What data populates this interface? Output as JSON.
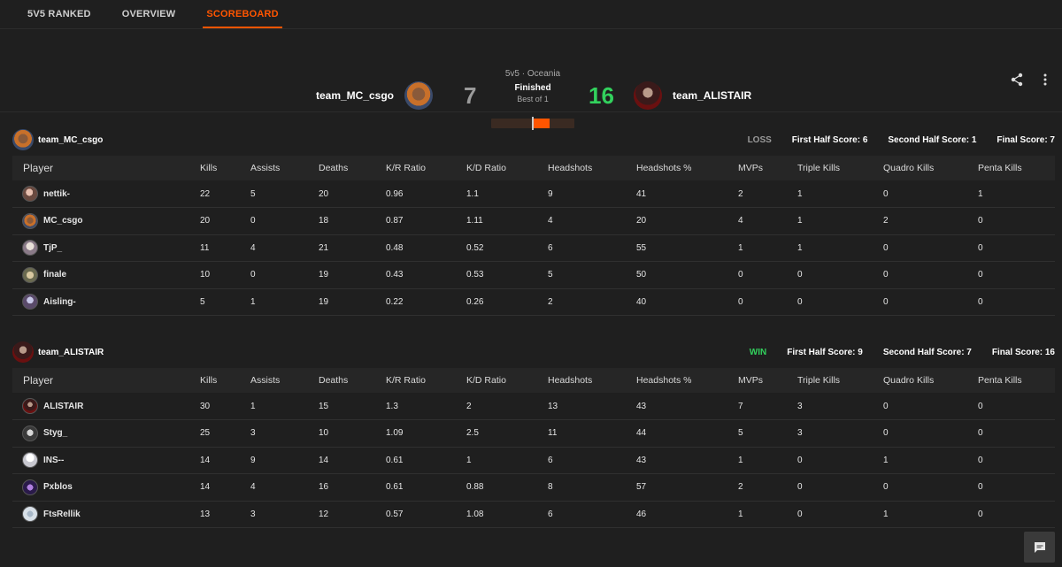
{
  "nav": {
    "tabs": [
      {
        "label": "5V5 RANKED"
      },
      {
        "label": "OVERVIEW"
      },
      {
        "label": "SCOREBOARD",
        "active": true
      }
    ]
  },
  "match": {
    "region": "5v5 · Oceania",
    "status": "Finished",
    "best_of": "Best of 1",
    "team_left": {
      "name": "team_MC_csgo",
      "score": "7"
    },
    "team_right": {
      "name": "team_ALISTAIR",
      "score": "16"
    },
    "progress_fraction": 0.4
  },
  "icons": {
    "share": "share-icon",
    "more": "more-vertical-icon",
    "chat": "chat-icon"
  },
  "colors": {
    "accent": "#ff5500",
    "win": "#32d15d",
    "loss": "#9a9a9a"
  },
  "columns": [
    "Player",
    "Kills",
    "Assists",
    "Deaths",
    "K/R Ratio",
    "K/D Ratio",
    "Headshots",
    "Headshots %",
    "MVPs",
    "Triple Kills",
    "Quadro Kills",
    "Penta Kills"
  ],
  "teams": [
    {
      "name": "team_MC_csgo",
      "result": "LOSS",
      "first_half": "First Half Score: 6",
      "second_half": "Second Half Score: 1",
      "final": "Final Score: 7",
      "players": [
        [
          "nettik-",
          "22",
          "5",
          "20",
          "0.96",
          "1.1",
          "9",
          "41",
          "2",
          "1",
          "0",
          "1"
        ],
        [
          "MC_csgo",
          "20",
          "0",
          "18",
          "0.87",
          "1.11",
          "4",
          "20",
          "4",
          "1",
          "2",
          "0"
        ],
        [
          "TjP_",
          "11",
          "4",
          "21",
          "0.48",
          "0.52",
          "6",
          "55",
          "1",
          "1",
          "0",
          "0"
        ],
        [
          "finale",
          "10",
          "0",
          "19",
          "0.43",
          "0.53",
          "5",
          "50",
          "0",
          "0",
          "0",
          "0"
        ],
        [
          "Aisling-",
          "5",
          "1",
          "19",
          "0.22",
          "0.26",
          "2",
          "40",
          "0",
          "0",
          "0",
          "0"
        ]
      ]
    },
    {
      "name": "team_ALISTAIR",
      "result": "WIN",
      "first_half": "First Half Score: 9",
      "second_half": "Second Half Score: 7",
      "final": "Final Score: 16",
      "players": [
        [
          "ALISTAIR",
          "30",
          "1",
          "15",
          "1.3",
          "2",
          "13",
          "43",
          "7",
          "3",
          "0",
          "0"
        ],
        [
          "Styg_",
          "25",
          "3",
          "10",
          "1.09",
          "2.5",
          "11",
          "44",
          "5",
          "3",
          "0",
          "0"
        ],
        [
          "INS--",
          "14",
          "9",
          "14",
          "0.61",
          "1",
          "6",
          "43",
          "1",
          "0",
          "1",
          "0"
        ],
        [
          "Pxblos",
          "14",
          "4",
          "16",
          "0.61",
          "0.88",
          "8",
          "57",
          "2",
          "0",
          "0",
          "0"
        ],
        [
          "FtsRellik",
          "13",
          "3",
          "12",
          "0.57",
          "1.08",
          "6",
          "46",
          "1",
          "0",
          "1",
          "0"
        ]
      ]
    }
  ]
}
